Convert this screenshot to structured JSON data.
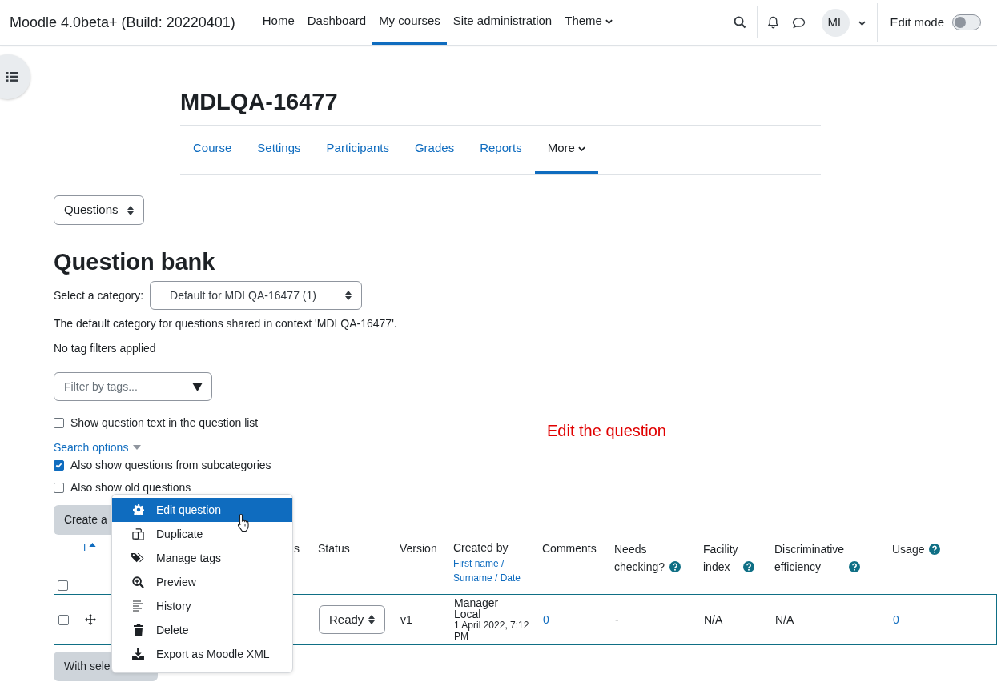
{
  "navbar": {
    "site_name": "Moodle 4.0beta+ (Build: 20220401)",
    "links": [
      {
        "label": "Home",
        "selected": false,
        "has_menu": false
      },
      {
        "label": "Dashboard",
        "selected": false,
        "has_menu": false
      },
      {
        "label": "My courses",
        "selected": true,
        "has_menu": false
      },
      {
        "label": "Site administration",
        "selected": false,
        "has_menu": false
      },
      {
        "label": "Theme",
        "selected": false,
        "has_menu": true
      }
    ],
    "avatar": "ML",
    "edit_mode": {
      "label": "Edit mode",
      "on": false
    }
  },
  "course": {
    "title": "MDLQA-16477",
    "tabs": [
      {
        "label": "Course",
        "selected": false,
        "has_menu": false
      },
      {
        "label": "Settings",
        "selected": false,
        "has_menu": false
      },
      {
        "label": "Participants",
        "selected": false,
        "has_menu": false
      },
      {
        "label": "Grades",
        "selected": false,
        "has_menu": false
      },
      {
        "label": "Reports",
        "selected": false,
        "has_menu": false
      },
      {
        "label": "More",
        "selected": true,
        "has_menu": true
      }
    ]
  },
  "page_select": "Questions",
  "heading": "Question bank",
  "category": {
    "label": "Select a category:",
    "value": "Default for MDLQA-16477 (1)"
  },
  "category_note": "The default category for questions shared in context 'MDLQA-16477'.",
  "tag_note": "No tag filters applied",
  "tag_filter": {
    "placeholder": "Filter by tags..."
  },
  "show_text_option": {
    "label": "Show question text in the question list",
    "checked": false
  },
  "search_options": "Search options",
  "search_checkboxes": [
    {
      "label": "Also show questions from subcategories",
      "checked": true
    },
    {
      "label": "Also show old questions",
      "checked": false
    }
  ],
  "annotation": "Edit the question",
  "create_button": "Create a",
  "table": {
    "columns": [
      {
        "kind": "checkbox",
        "checked": false
      },
      {
        "kind": "sort",
        "label": "T"
      },
      {
        "kind": "blank"
      },
      {
        "kind": "text",
        "label": "s"
      },
      {
        "kind": "text",
        "label": "Status"
      },
      {
        "kind": "text",
        "label": "Version"
      },
      {
        "kind": "sortlinks",
        "label": "Created by",
        "links": "First name / Surname / Date"
      },
      {
        "kind": "text",
        "label": "Comments"
      },
      {
        "kind": "help",
        "label": "Needs checking?"
      },
      {
        "kind": "help",
        "label": "Facility index"
      },
      {
        "kind": "help",
        "label": "Discriminative efficiency"
      },
      {
        "kind": "help",
        "label": "Usage"
      }
    ],
    "rows": [
      {
        "checked": false,
        "status": "Ready",
        "version": "v1",
        "created_by": "Manager Local",
        "created_date": "1 April 2022, 7:12 PM",
        "comments": "0",
        "needs_checking": "-",
        "facility_index": "N/A",
        "discriminative_efficiency": "N/A",
        "usage": "0"
      }
    ]
  },
  "with_selected_button": "With sele",
  "context_menu": {
    "items": [
      {
        "kind": "edit",
        "label": "Edit question",
        "selected": true
      },
      {
        "kind": "duplicate",
        "label": "Duplicate",
        "selected": false
      },
      {
        "kind": "tags",
        "label": "Manage tags",
        "selected": false
      },
      {
        "kind": "preview",
        "label": "Preview",
        "selected": false
      },
      {
        "kind": "history",
        "label": "History",
        "selected": false
      },
      {
        "kind": "delete",
        "label": "Delete",
        "selected": false
      },
      {
        "kind": "export",
        "label": "Export as Moodle XML",
        "selected": false
      }
    ]
  }
}
